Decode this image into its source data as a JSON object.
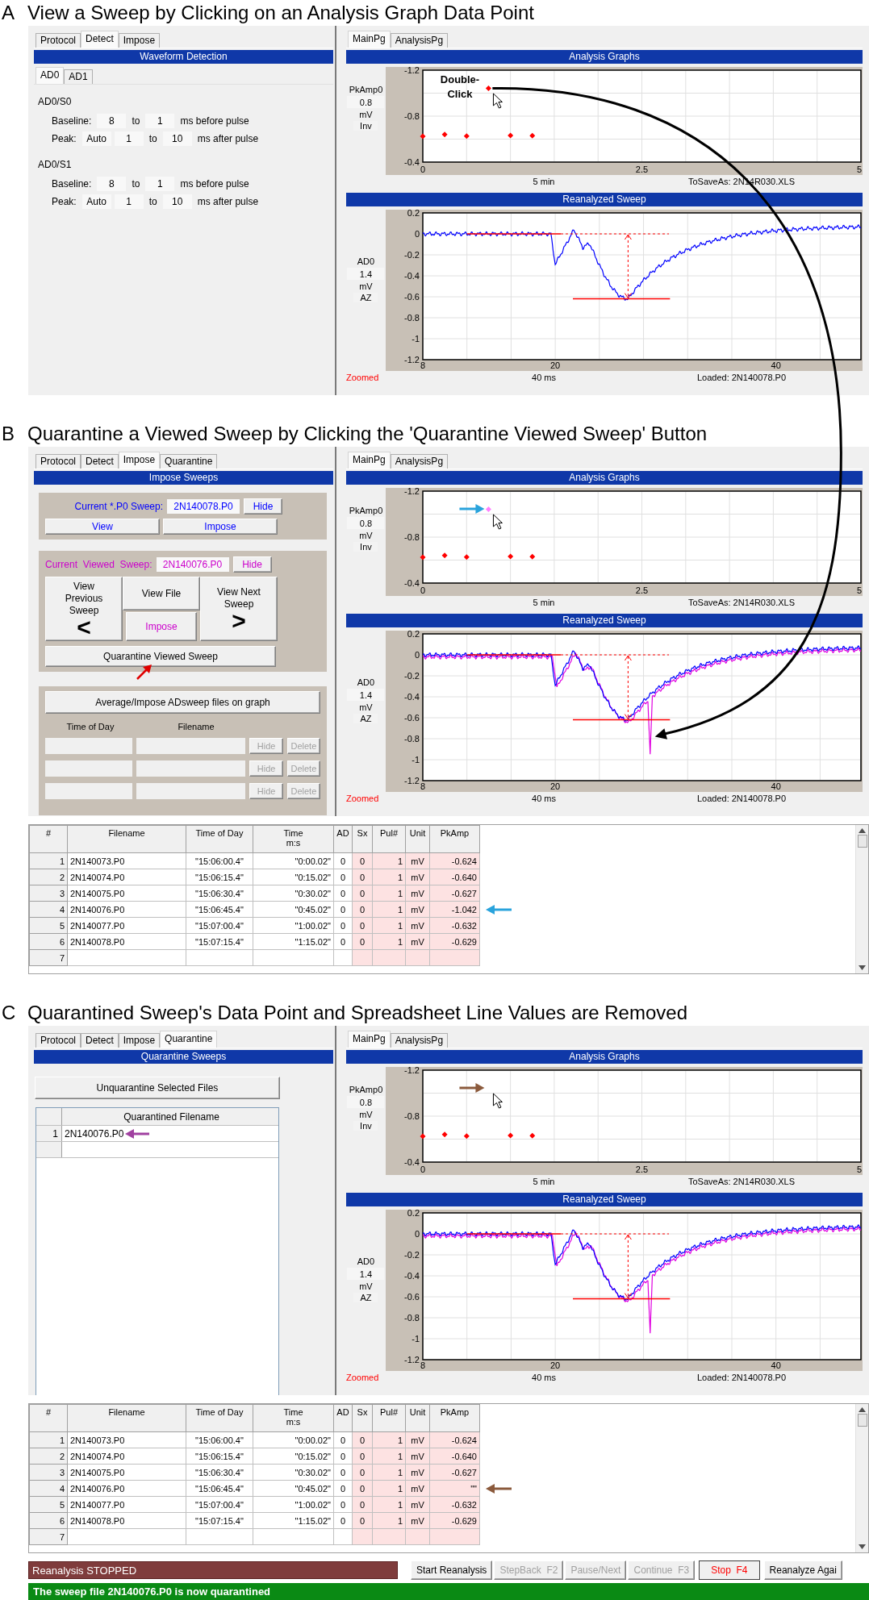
{
  "sections": [
    {
      "letter": "A",
      "title": "View a Sweep by Clicking on an Analysis Graph Data Point",
      "left": {
        "kind": "detect",
        "tabs": [
          {
            "label": "Protocol",
            "selected": false
          },
          {
            "label": "Detect",
            "selected": true
          },
          {
            "label": "Impose",
            "selected": false
          }
        ],
        "header": "Waveform Detection",
        "subtabs": [
          {
            "label": "AD0",
            "selected": true
          },
          {
            "label": "AD1",
            "selected": false
          }
        ],
        "groups": [
          {
            "title": "AD0/S0",
            "rows": [
              [
                {
                  "kind": "label",
                  "text": "Baseline:"
                },
                {
                  "kind": "field",
                  "value": "8"
                },
                {
                  "kind": "label",
                  "text": "to"
                },
                {
                  "kind": "field",
                  "value": "1"
                },
                {
                  "kind": "label",
                  "text": "ms before pulse"
                }
              ],
              [
                {
                  "kind": "label",
                  "text": "Peak:"
                },
                {
                  "kind": "field",
                  "value": "Auto"
                },
                {
                  "kind": "field",
                  "value": "1"
                },
                {
                  "kind": "label",
                  "text": "to"
                },
                {
                  "kind": "field",
                  "value": "10"
                },
                {
                  "kind": "label",
                  "text": "ms after pulse"
                }
              ]
            ]
          },
          {
            "title": "AD0/S1",
            "rows": [
              [
                {
                  "kind": "label",
                  "text": "Baseline:"
                },
                {
                  "kind": "field",
                  "value": "8"
                },
                {
                  "kind": "label",
                  "text": "to"
                },
                {
                  "kind": "field",
                  "value": "1"
                },
                {
                  "kind": "label",
                  "text": "ms before pulse"
                }
              ],
              [
                {
                  "kind": "label",
                  "text": "Peak:"
                },
                {
                  "kind": "field",
                  "value": "Auto"
                },
                {
                  "kind": "field",
                  "value": "1"
                },
                {
                  "kind": "label",
                  "text": "to"
                },
                {
                  "kind": "field",
                  "value": "10"
                },
                {
                  "kind": "label",
                  "text": "ms after pulse"
                }
              ]
            ]
          }
        ]
      },
      "right": {
        "tabs": [
          {
            "label": "MainPg",
            "selected": true
          },
          {
            "label": "AnalysisPg",
            "selected": false
          }
        ],
        "analysis": {
          "header": "Analysis Graphs",
          "scale": [
            {
              "kind": "field",
              "text": "0.8"
            },
            {
              "kind": "label",
              "text": "mV"
            },
            {
              "kind": "button",
              "text": "Inv"
            }
          ],
          "note": "ToSaveAs: 2N14R030.XLS",
          "callout": "Double-Click",
          "chart_data": {
            "type": "scatter",
            "ylabel": "PkAmp0",
            "xlabel": "5 min",
            "x": [
              0,
              0.25,
              0.5,
              0.75,
              1,
              1.25
            ],
            "series": [
              {
                "color": "#ff0000",
                "values": [
                  -0.624,
                  -0.64,
                  -0.627,
                  -1.042,
                  -0.632,
                  -0.629
                ]
              }
            ],
            "xlim": [
              0,
              5
            ],
            "ylim": [
              -0.4,
              -1.2
            ],
            "xticks": [
              0,
              2.5,
              5
            ],
            "yticks": [
              -1.2,
              -0.8,
              -0.4
            ]
          }
        },
        "sweep": {
          "header": "Reanalyzed Sweep",
          "ylabel": "AD0",
          "scale": [
            {
              "kind": "field",
              "text": "1.4"
            },
            {
              "kind": "label",
              "text": "mV"
            },
            {
              "kind": "button",
              "text": "AZ"
            }
          ],
          "yticks": [
            "0.2",
            "0",
            "-0.2",
            "-0.4",
            "-0.6",
            "-0.8",
            "-1",
            "-1.2"
          ],
          "xticks": [
            "8",
            "20",
            "40"
          ],
          "status": "Zoomed",
          "xlabel": "40 ms",
          "note": "Loaded: 2N140078.P0",
          "overlay": false
        }
      }
    },
    {
      "letter": "B",
      "title": "Quarantine a Viewed Sweep by Clicking the 'Quarantine Viewed Sweep' Button",
      "left": {
        "kind": "impose",
        "tabs": [
          {
            "label": "Protocol",
            "selected": false
          },
          {
            "label": "Detect",
            "selected": false
          },
          {
            "label": "Impose",
            "selected": true
          },
          {
            "label": "Quarantine",
            "selected": false
          }
        ],
        "header": "Impose Sweeps",
        "current": {
          "label": "Current *.P0 Sweep:",
          "value": "2N140078.P0",
          "hide": "Hide",
          "buttons": [
            "View",
            "Impose"
          ],
          "color": "#0000ff"
        },
        "viewed": {
          "label": "Current  Viewed  Sweep:",
          "value": "2N140076.P0",
          "hide": "Hide",
          "prev": {
            "label": "View Previous Sweep",
            "glyph": "<"
          },
          "file": "View File",
          "impose": "Impose",
          "next": {
            "label": "View Next Sweep",
            "glyph": ">"
          },
          "quarantine": {
            "label": "Quarantine Viewed Sweep",
            "arrow": {
              "color": "#e00000"
            }
          },
          "color": "#cc00cc"
        },
        "average": {
          "button": "Average/Impose ADsweep files on graph",
          "columns": [
            "Time of Day",
            "Filename"
          ],
          "rows": [
            {
              "buttons": [
                {
                  "label": "Hide",
                  "disabled": true
                },
                {
                  "label": "Delete",
                  "disabled": true
                }
              ]
            },
            {
              "buttons": [
                {
                  "label": "Hide",
                  "disabled": true
                },
                {
                  "label": "Delete",
                  "disabled": true
                }
              ]
            },
            {
              "buttons": [
                {
                  "label": "Hide",
                  "disabled": true
                },
                {
                  "label": "Delete",
                  "disabled": true
                }
              ]
            }
          ]
        }
      },
      "right": {
        "tabs": [
          {
            "label": "MainPg",
            "selected": true
          },
          {
            "label": "AnalysisPg",
            "selected": false
          }
        ],
        "analysis": {
          "header": "Analysis Graphs",
          "scale": [
            {
              "kind": "field",
              "text": "0.8"
            },
            {
              "kind": "label",
              "text": "mV"
            },
            {
              "kind": "button",
              "text": "Inv"
            }
          ],
          "note": "ToSaveAs: 2N14R030.XLS",
          "arrow": {
            "color": "#29a3dc"
          },
          "chart_data": {
            "type": "scatter",
            "ylabel": "PkAmp0",
            "xlabel": "5 min",
            "x": [
              0,
              0.25,
              0.5,
              0.75,
              1,
              1.25
            ],
            "series": [
              {
                "color": "#ff0000",
                "values": [
                  -0.624,
                  -0.64,
                  -0.627,
                  null,
                  -0.632,
                  -0.629
                ]
              },
              {
                "color": "#ff80ff",
                "values": [
                  null,
                  null,
                  null,
                  -1.042,
                  null,
                  null
                ]
              }
            ],
            "xlim": [
              0,
              5
            ],
            "ylim": [
              -0.4,
              -1.2
            ],
            "xticks": [
              0,
              2.5,
              5
            ],
            "yticks": [
              -1.2,
              -0.8,
              -0.4
            ]
          }
        },
        "sweep": {
          "header": "Reanalyzed Sweep",
          "ylabel": "AD0",
          "scale": [
            {
              "kind": "field",
              "text": "1.4"
            },
            {
              "kind": "label",
              "text": "mV"
            },
            {
              "kind": "button",
              "text": "AZ"
            }
          ],
          "yticks": [
            "0.2",
            "0",
            "-0.2",
            "-0.4",
            "-0.6",
            "-0.8",
            "-1",
            "-1.2"
          ],
          "xticks": [
            "8",
            "20",
            "40"
          ],
          "status": "Zoomed",
          "xlabel": "40 ms",
          "note": "Loaded: 2N140078.P0",
          "overlay": true
        }
      },
      "table": {
        "columns": [
          {
            "label": "#",
            "shaded": false
          },
          {
            "label": "Filename",
            "shaded": false
          },
          {
            "label": "Time of Day",
            "shaded": false
          },
          {
            "label": "Time",
            "sub": "m:s",
            "shaded": false
          },
          {
            "label": "AD",
            "shaded": false
          },
          {
            "label": "Sx",
            "shaded": true
          },
          {
            "label": "Pul#",
            "shaded": true
          },
          {
            "label": "Unit",
            "shaded": true
          },
          {
            "label": "PkAmp",
            "shaded": true
          }
        ],
        "rows": [
          {
            "cells": [
              "1",
              "2N140073.P0",
              "\"15:06:00.4\"",
              "\"0:00.02\"",
              "0",
              "0",
              "1",
              "mV",
              "-0.624"
            ]
          },
          {
            "cells": [
              "2",
              "2N140074.P0",
              "\"15:06:15.4\"",
              "\"0:15.02\"",
              "0",
              "0",
              "1",
              "mV",
              "-0.640"
            ]
          },
          {
            "cells": [
              "3",
              "2N140075.P0",
              "\"15:06:30.4\"",
              "\"0:30.02\"",
              "0",
              "0",
              "1",
              "mV",
              "-0.627"
            ]
          },
          {
            "cells": [
              "4",
              "2N140076.P0",
              "\"15:06:45.4\"",
              "\"0:45.02\"",
              "0",
              "0",
              "1",
              "mV",
              "-1.042"
            ],
            "arrow": {
              "color": "#29a3dc"
            }
          },
          {
            "cells": [
              "5",
              "2N140077.P0",
              "\"15:07:00.4\"",
              "\"1:00.02\"",
              "0",
              "0",
              "1",
              "mV",
              "-0.632"
            ]
          },
          {
            "cells": [
              "6",
              "2N140078.P0",
              "\"15:07:15.4\"",
              "\"1:15.02\"",
              "0",
              "0",
              "1",
              "mV",
              "-0.629"
            ]
          },
          {
            "cells": [
              "7"
            ]
          }
        ]
      }
    },
    {
      "letter": "C",
      "title": "Quarantined Sweep's Data Point and Spreadsheet Line Values are Removed",
      "left": {
        "kind": "quarantine",
        "tabs": [
          {
            "label": "Protocol",
            "selected": false
          },
          {
            "label": "Detect",
            "selected": false
          },
          {
            "label": "Impose",
            "selected": false
          },
          {
            "label": "Quarantine",
            "selected": true
          }
        ],
        "header": "Quarantine Sweeps",
        "button": "Unquarantine Selected Files",
        "list": {
          "column": "Quarantined Filename",
          "rows": [
            {
              "num": "1",
              "name": "2N140076.P0",
              "arrow": {
                "color": "#a040a0"
              }
            }
          ]
        }
      },
      "right": {
        "tabs": [
          {
            "label": "MainPg",
            "selected": true
          },
          {
            "label": "AnalysisPg",
            "selected": false
          }
        ],
        "analysis": {
          "header": "Analysis Graphs",
          "scale": [
            {
              "kind": "field",
              "text": "0.8"
            },
            {
              "kind": "label",
              "text": "mV"
            },
            {
              "kind": "button",
              "text": "Inv"
            }
          ],
          "note": "ToSaveAs: 2N14R030.XLS",
          "arrow": {
            "color": "#8b5a3c"
          },
          "chart_data": {
            "type": "scatter",
            "ylabel": "PkAmp0",
            "xlabel": "5 min",
            "x": [
              0,
              0.25,
              0.5,
              0.75,
              1,
              1.25
            ],
            "series": [
              {
                "color": "#ff0000",
                "values": [
                  -0.624,
                  -0.64,
                  -0.627,
                  null,
                  -0.632,
                  -0.629
                ]
              }
            ],
            "xlim": [
              0,
              5
            ],
            "ylim": [
              -0.4,
              -1.2
            ],
            "xticks": [
              0,
              2.5,
              5
            ],
            "yticks": [
              -1.2,
              -0.8,
              -0.4
            ]
          }
        },
        "sweep": {
          "header": "Reanalyzed Sweep",
          "ylabel": "AD0",
          "scale": [
            {
              "kind": "field",
              "text": "1.4"
            },
            {
              "kind": "label",
              "text": "mV"
            },
            {
              "kind": "button",
              "text": "AZ"
            }
          ],
          "yticks": [
            "0.2",
            "0",
            "-0.2",
            "-0.4",
            "-0.6",
            "-0.8",
            "-1",
            "-1.2"
          ],
          "xticks": [
            "8",
            "20",
            "40"
          ],
          "status": "Zoomed",
          "xlabel": "40 ms",
          "note": "Loaded: 2N140078.P0",
          "overlay": true
        }
      },
      "table": {
        "columns": [
          {
            "label": "#",
            "shaded": false
          },
          {
            "label": "Filename",
            "shaded": false
          },
          {
            "label": "Time of Day",
            "shaded": false
          },
          {
            "label": "Time",
            "sub": "m:s",
            "shaded": false
          },
          {
            "label": "AD",
            "shaded": false
          },
          {
            "label": "Sx",
            "shaded": true
          },
          {
            "label": "Pul#",
            "shaded": true
          },
          {
            "label": "Unit",
            "shaded": true
          },
          {
            "label": "PkAmp",
            "shaded": true
          }
        ],
        "rows": [
          {
            "cells": [
              "1",
              "2N140073.P0",
              "\"15:06:00.4\"",
              "\"0:00.02\"",
              "0",
              "0",
              "1",
              "mV",
              "-0.624"
            ]
          },
          {
            "cells": [
              "2",
              "2N140074.P0",
              "\"15:06:15.4\"",
              "\"0:15.02\"",
              "0",
              "0",
              "1",
              "mV",
              "-0.640"
            ]
          },
          {
            "cells": [
              "3",
              "2N140075.P0",
              "\"15:06:30.4\"",
              "\"0:30.02\"",
              "0",
              "0",
              "1",
              "mV",
              "-0.627"
            ]
          },
          {
            "cells": [
              "4",
              "2N140076.P0",
              "\"15:06:45.4\"",
              "\"0:45.02\"",
              "0",
              "0",
              "1",
              "mV",
              "\"\""
            ],
            "arrow": {
              "color": "#8b5a3c"
            }
          },
          {
            "cells": [
              "5",
              "2N140077.P0",
              "\"15:07:00.4\"",
              "\"1:00.02\"",
              "0",
              "0",
              "1",
              "mV",
              "-0.632"
            ]
          },
          {
            "cells": [
              "6",
              "2N140078.P0",
              "\"15:07:15.4\"",
              "\"1:15.02\"",
              "0",
              "0",
              "1",
              "mV",
              "-0.629"
            ]
          },
          {
            "cells": [
              "7"
            ]
          }
        ]
      }
    }
  ],
  "status": {
    "state": "Reanalysis STOPPED",
    "buttons": [
      {
        "label": "Start Reanalysis",
        "disabled": false,
        "kind": "normal"
      },
      {
        "label": "StepBack  F2",
        "disabled": true,
        "kind": "normal"
      },
      {
        "label": "Pause/Next",
        "disabled": true,
        "kind": "normal"
      },
      {
        "label": "Continue  F3",
        "disabled": true,
        "kind": "normal"
      },
      {
        "label": "Stop  F4",
        "disabled": false,
        "kind": "stop"
      },
      {
        "label": "Reanalyze Agai",
        "disabled": false,
        "kind": "normal"
      }
    ],
    "message": "The sweep file 2N140076.P0 is now quarantined"
  }
}
